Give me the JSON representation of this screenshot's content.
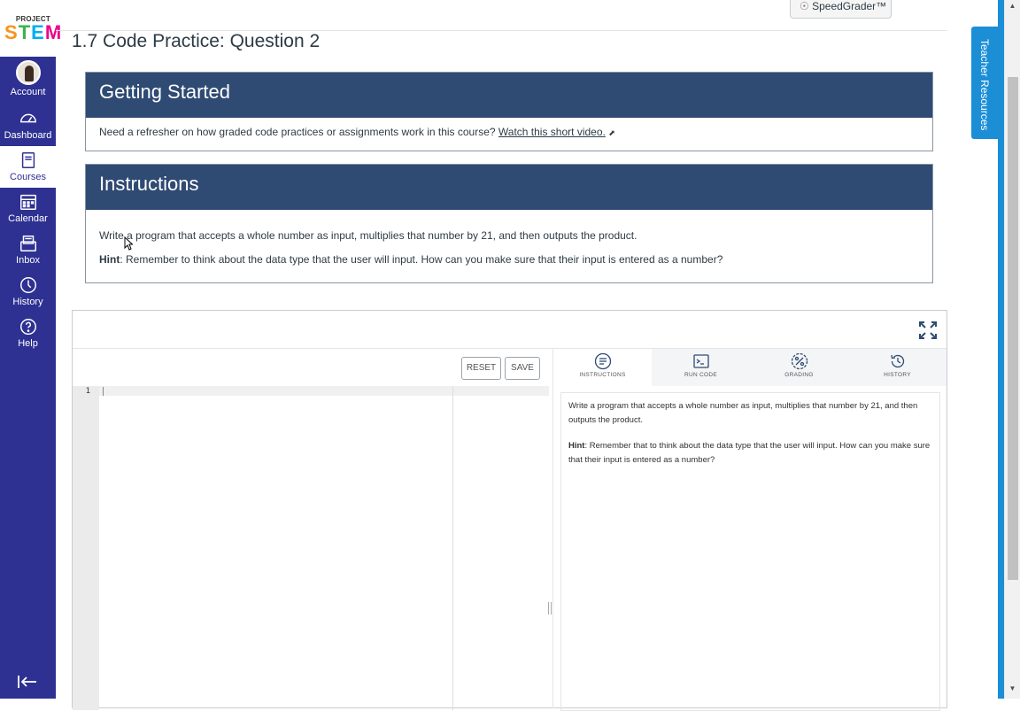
{
  "nav": {
    "logo_top": "PROJECT",
    "logo_main": "STEM",
    "items": [
      {
        "label": "Account",
        "icon": "avatar"
      },
      {
        "label": "Dashboard",
        "icon": "dashboard-icon"
      },
      {
        "label": "Courses",
        "icon": "book-icon"
      },
      {
        "label": "Calendar",
        "icon": "calendar-icon"
      },
      {
        "label": "Inbox",
        "icon": "inbox-icon"
      },
      {
        "label": "History",
        "icon": "clock-icon"
      },
      {
        "label": "Help",
        "icon": "help-icon"
      }
    ],
    "active": "Courses"
  },
  "header": {
    "title": "1.7 Code Practice: Question 2",
    "speedgrader": "SpeedGrader™"
  },
  "getting_started": {
    "heading": "Getting Started",
    "text": "Need a refresher on how graded code practices or assignments work in this course? ",
    "link": "Watch this short video."
  },
  "instructions": {
    "heading": "Instructions",
    "line1": "Write a program that accepts a whole number as input, multiplies that number by 21, and then outputs the product.",
    "hint_label": "Hint",
    "hint_text": ": Remember to think about the data type that the user will input. How can you make sure that their input is entered as a number?"
  },
  "editor": {
    "reset_label": "RESET",
    "save_label": "SAVE",
    "line_number": "1"
  },
  "tabs": [
    {
      "label": "INSTRUCTIONS",
      "icon": "list-icon"
    },
    {
      "label": "RUN CODE",
      "icon": "terminal-icon"
    },
    {
      "label": "GRADING",
      "icon": "percent-icon"
    },
    {
      "label": "HISTORY",
      "icon": "history-icon"
    }
  ],
  "panel_instructions": {
    "line1": "Write a program that accepts a whole number as input, multiplies that number by 21, and then outputs the product.",
    "hint_label": "Hint",
    "hint_text": ": Remember that to think about the data type that the user will input. How can you make sure that their input is entered as a number?"
  },
  "side_tab": "Teacher Resources",
  "colors": {
    "nav_bg": "#2e3192",
    "panel_header": "#2f4b73",
    "teacher_tab": "#1b8ed6"
  }
}
